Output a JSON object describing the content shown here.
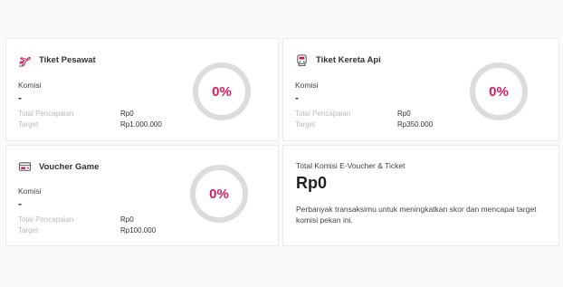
{
  "cards": [
    {
      "title": "Tiket Pesawat",
      "icon": "airplane-icon",
      "komisi_label": "Komisi",
      "komisi_value": "-",
      "total_label": "Total Pencapaian",
      "total_value": "Rp0",
      "target_label": "Target",
      "target_value": "Rp1.000.000",
      "percent": "0%"
    },
    {
      "title": "Tiket Kereta Api",
      "icon": "train-icon",
      "komisi_label": "Komisi",
      "komisi_value": "-",
      "total_label": "Total Pencapaian",
      "total_value": "Rp0",
      "target_label": "Target",
      "target_value": "Rp350.000",
      "percent": "0%"
    },
    {
      "title": "Voucher Game",
      "icon": "game-voucher-icon",
      "komisi_label": "Komisi",
      "komisi_value": "-",
      "total_label": "Total Pencapaian",
      "total_value": "Rp0",
      "target_label": "Target",
      "target_value": "Rp100.000",
      "percent": "0%"
    }
  ],
  "summary": {
    "title": "Total Komisi E-Voucher & Ticket",
    "amount": "Rp0",
    "description": "Perbanyak transaksimu untuk meningkatkan skor dan mencapai target komisi pekan ini."
  },
  "colors": {
    "accent": "#d81b60",
    "ring": "#dcdcdc"
  }
}
